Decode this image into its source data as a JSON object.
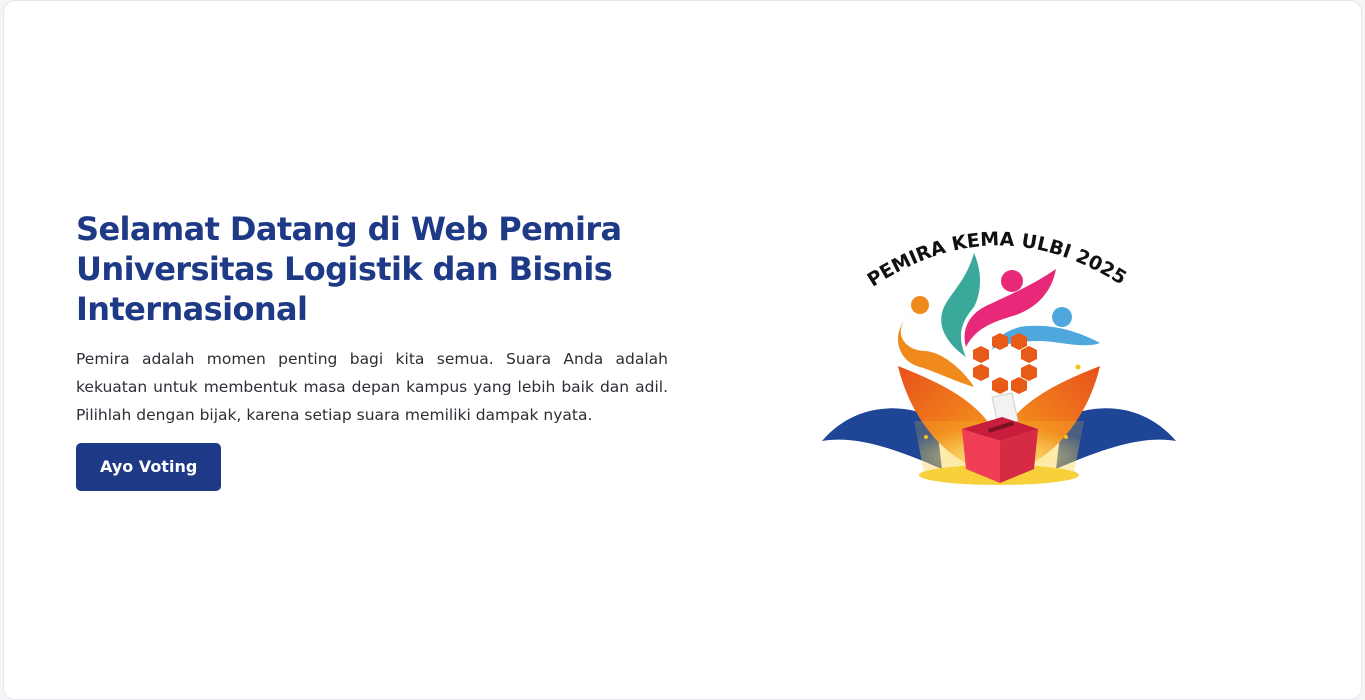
{
  "hero": {
    "title": "Selamat Datang di Web Pemira Universitas Logistik dan Bisnis Internasional",
    "description": "Pemira adalah momen penting bagi kita semua. Suara Anda adalah kekuatan untuk membentuk masa depan kampus yang lebih baik dan adil. Pilihlah dengan bijak, karena setiap suara memiliki dampak nyata.",
    "button_label": "Ayo Voting"
  },
  "logo": {
    "arc_text": "PEMIRA KEMA ULBI 2025"
  },
  "colors": {
    "primary": "#1e3a86",
    "text": "#2b2f36",
    "background": "#ffffff"
  }
}
